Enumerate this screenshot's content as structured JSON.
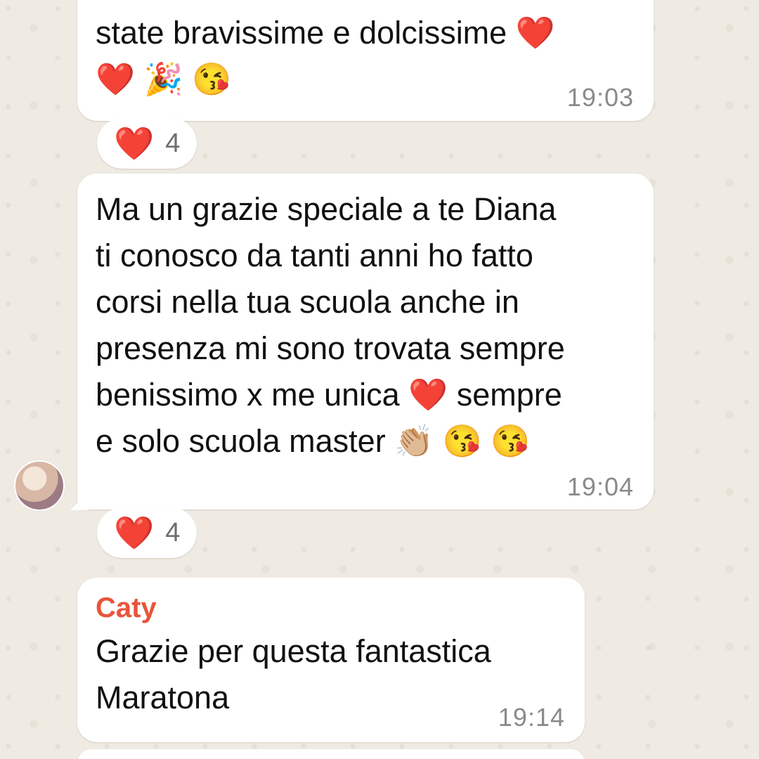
{
  "messages": [
    {
      "lines": [
        "state bravissime e dolcissime ❤️",
        "❤️ 🎉 😘"
      ],
      "time": "19:03",
      "reaction": {
        "emoji": "❤️",
        "count": "4"
      }
    },
    {
      "lines": [
        "Ma un grazie speciale a te Diana",
        "ti conosco da tanti anni ho fatto",
        "corsi nella tua scuola anche in",
        "presenza mi sono trovata sempre",
        "benissimo x me unica ❤️ sempre",
        "e solo scuola master 👏🏼 😘 😘"
      ],
      "time": "19:04",
      "reaction": {
        "emoji": "❤️",
        "count": "4"
      }
    },
    {
      "sender": "Caty",
      "sender_color": "#E8543A",
      "lines": [
        "Grazie per questa fantastica",
        "Maratona"
      ],
      "time": "19:14"
    }
  ],
  "colors": {
    "background": "#EFEAE2",
    "bubble": "#FFFFFF",
    "timestamp": "#8A8A8A",
    "heart": "#E0182D"
  }
}
